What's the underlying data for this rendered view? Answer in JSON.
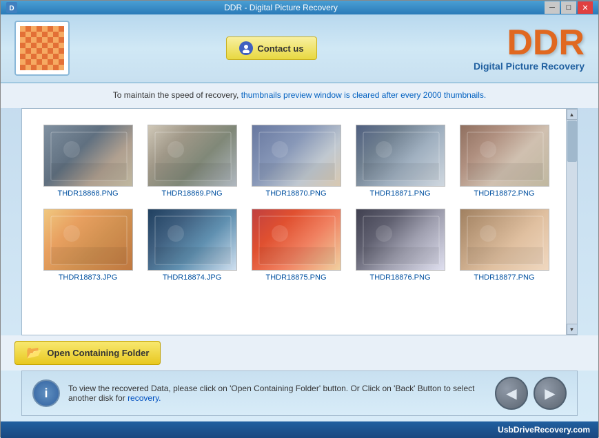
{
  "titlebar": {
    "title": "DDR - Digital Picture Recovery",
    "minimize_label": "─",
    "maximize_label": "□",
    "close_label": "✕"
  },
  "header": {
    "contact_button_label": "Contact us",
    "ddr_logo": "DDR",
    "subtitle": "Digital Picture Recovery"
  },
  "notice": {
    "text_before": "To maintain the speed of recovery, ",
    "text_highlight": "thumbnails preview window is cleared after every 2000 thumbnails.",
    "text_after": ""
  },
  "thumbnails": [
    {
      "id": 1,
      "label": "THDR18868.PNG",
      "color_class": "p1"
    },
    {
      "id": 2,
      "label": "THDR18869.PNG",
      "color_class": "p2"
    },
    {
      "id": 3,
      "label": "THDR18870.PNG",
      "color_class": "p3"
    },
    {
      "id": 4,
      "label": "THDR18871.PNG",
      "color_class": "p4"
    },
    {
      "id": 5,
      "label": "THDR18872.PNG",
      "color_class": "p5"
    },
    {
      "id": 6,
      "label": "THDR18873.JPG",
      "color_class": "p6"
    },
    {
      "id": 7,
      "label": "THDR18874.JPG",
      "color_class": "p7"
    },
    {
      "id": 8,
      "label": "THDR18875.PNG",
      "color_class": "p8"
    },
    {
      "id": 9,
      "label": "THDR18876.PNG",
      "color_class": "p9"
    },
    {
      "id": 10,
      "label": "THDR18877.PNG",
      "color_class": "p10"
    }
  ],
  "action_bar": {
    "open_folder_label": "Open Containing Folder"
  },
  "info_bar": {
    "message_before": "To view the recovered Data, please click on 'Open Containing Folder' button. Or Click on 'Back' Button to select another disk for",
    "message_link": "recovery.",
    "back_icon": "◀",
    "forward_icon": "▶"
  },
  "bottom_bar": {
    "url": "UsbDriveRecovery.com"
  }
}
